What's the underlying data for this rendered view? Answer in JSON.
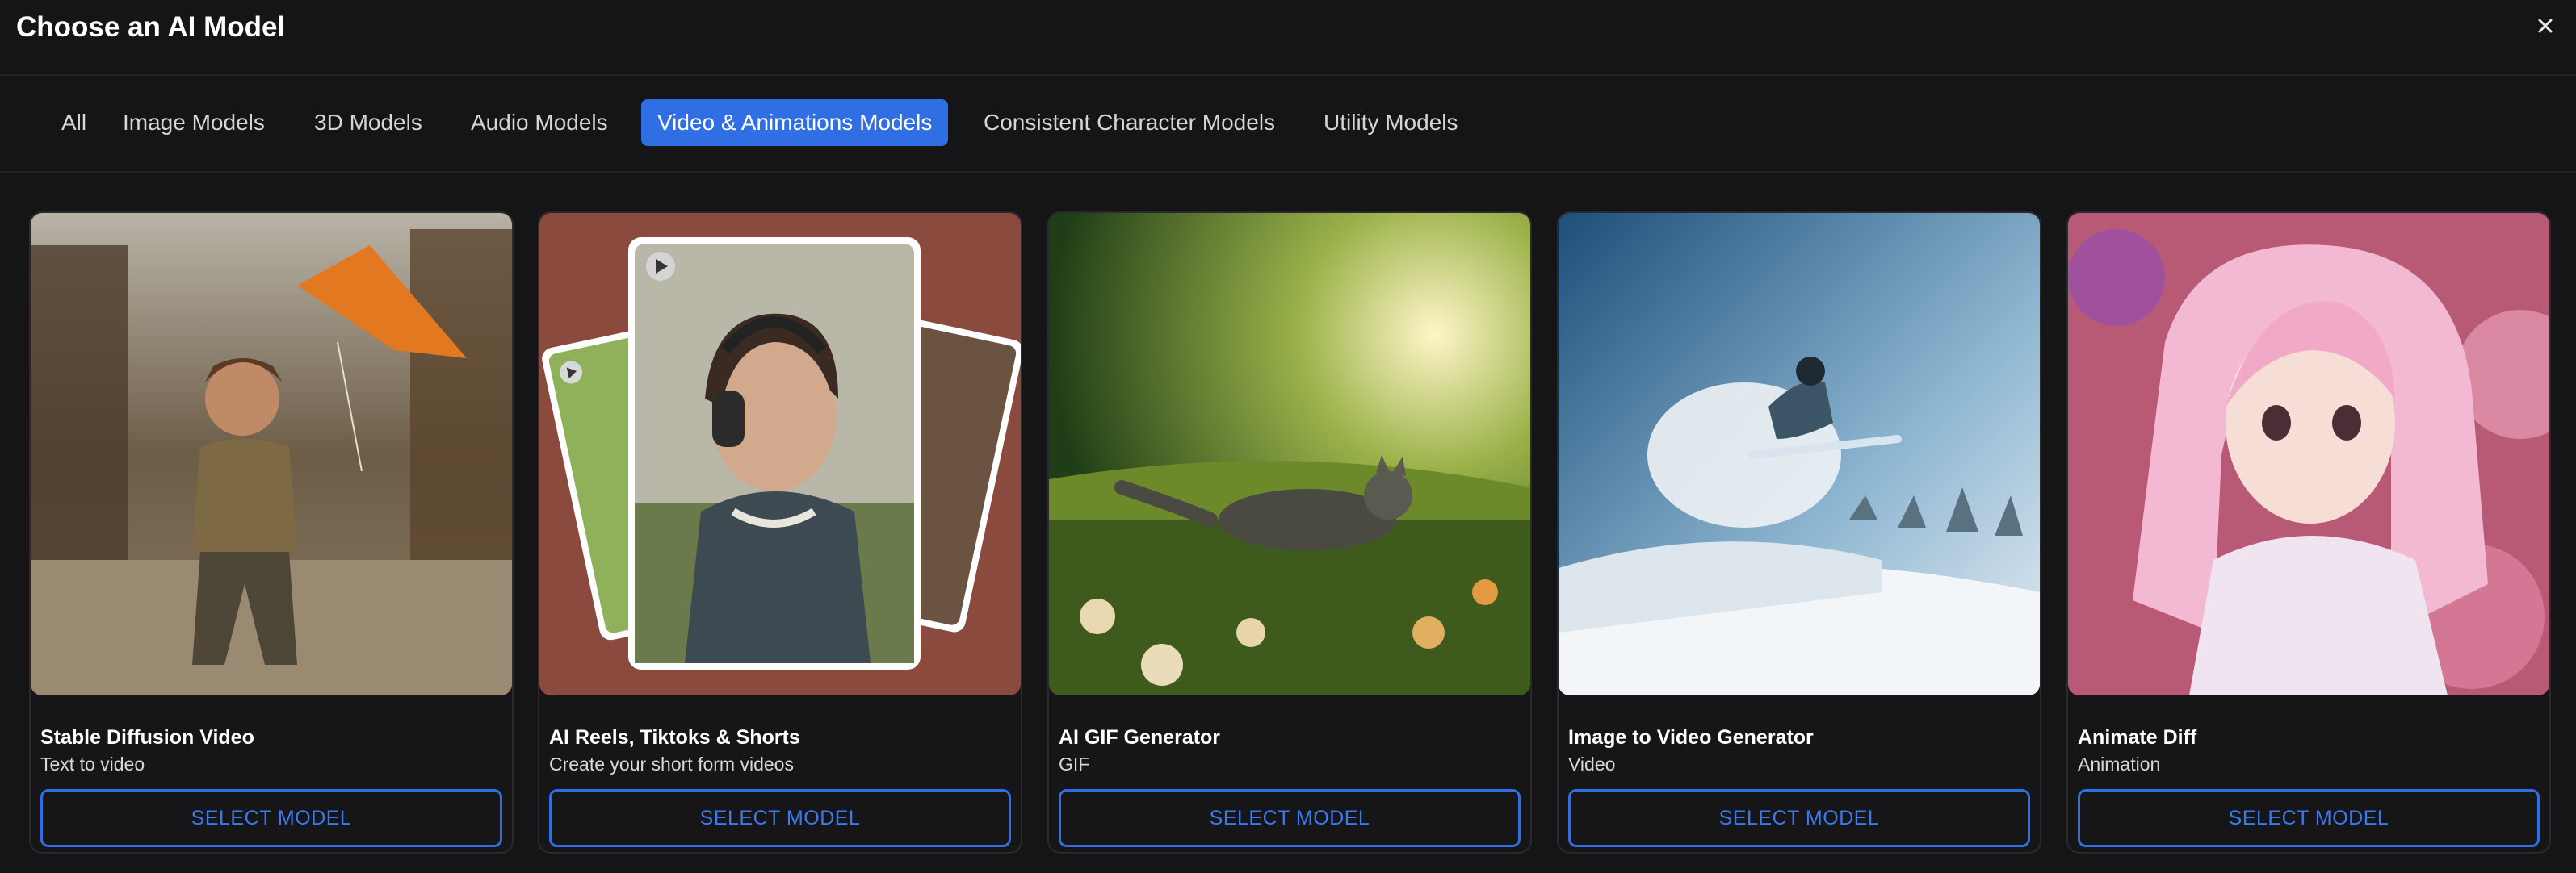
{
  "dialog": {
    "title": "Choose an AI Model",
    "close_icon": "close-icon"
  },
  "tabs": [
    {
      "label": "All",
      "active": false
    },
    {
      "label": "Image Models",
      "active": false
    },
    {
      "label": "3D Models",
      "active": false
    },
    {
      "label": "Audio Models",
      "active": false
    },
    {
      "label": "Video & Animations Models",
      "active": true
    },
    {
      "label": "Consistent Character Models",
      "active": false
    },
    {
      "label": "Utility Models",
      "active": false
    }
  ],
  "cards": [
    {
      "title": "Stable Diffusion Video",
      "subtitle": "Text to video",
      "button_label": "SELECT MODEL"
    },
    {
      "title": "AI Reels, Tiktoks & Shorts",
      "subtitle": "Create your short form videos",
      "button_label": "SELECT MODEL"
    },
    {
      "title": "AI GIF Generator",
      "subtitle": "GIF",
      "button_label": "SELECT MODEL"
    },
    {
      "title": "Image to Video Generator",
      "subtitle": "Video",
      "button_label": "SELECT MODEL"
    },
    {
      "title": "Animate Diff",
      "subtitle": "Animation",
      "button_label": "SELECT MODEL"
    }
  ],
  "colors": {
    "background": "#151517",
    "accent": "#2f6fe3",
    "card_border": "#2a2a2e",
    "tab_text": "#d6d6d9"
  }
}
